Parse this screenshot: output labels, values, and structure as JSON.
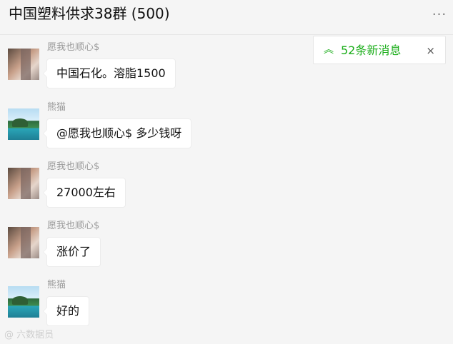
{
  "header": {
    "title": "中国塑料供求38群 (500)",
    "more_label": "···"
  },
  "new_messages": {
    "arrow_icon": "double-chevron-up-icon",
    "text": "52条新消息",
    "close_label": "×"
  },
  "messages": [
    {
      "sender": "愿我也顺心$",
      "avatar": "person-photo",
      "text": "中国石化。溶脂1500"
    },
    {
      "sender": "熊猫",
      "avatar": "scenery-photo",
      "text": "@愿我也顺心$ 多少钱呀"
    },
    {
      "sender": "愿我也顺心$",
      "avatar": "person-photo",
      "text": "27000左右"
    },
    {
      "sender": "愿我也顺心$",
      "avatar": "person-photo",
      "text": "涨价了"
    },
    {
      "sender": "熊猫",
      "avatar": "scenery-photo",
      "text": "好的"
    }
  ],
  "watermark": "@ 六数据员",
  "colors": {
    "accent": "#1aad19",
    "background": "#f5f5f5",
    "bubble": "#ffffff"
  }
}
